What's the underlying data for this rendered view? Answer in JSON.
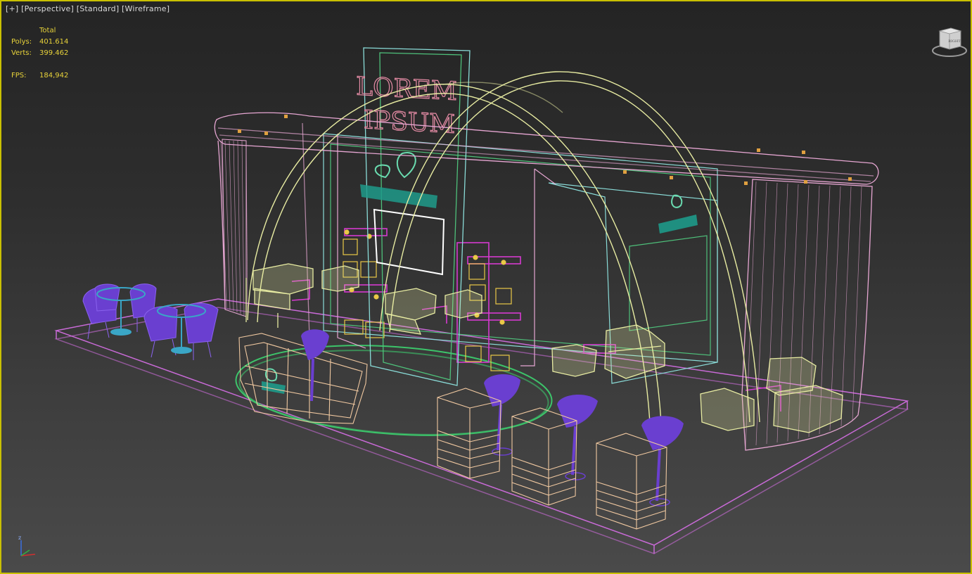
{
  "viewport": {
    "labels": [
      "[+]",
      "[Perspective]",
      "[Standard]",
      "[Wireframe]"
    ]
  },
  "stats": {
    "header": "Total",
    "polys_label": "Polys:",
    "polys_value": "401.614",
    "verts_label": "Verts:",
    "verts_value": "399.462",
    "fps_label": "FPS:",
    "fps_value": "184,942"
  },
  "scene": {
    "sign_line1": "LOREM",
    "sign_line2": "IPSUM"
  },
  "viewcube": {
    "face_label": "RIGHT"
  },
  "axis": {
    "z_label": "z"
  },
  "colors": {
    "viewport_border": "#c9c000",
    "stats_text": "#e8d33a",
    "curtain_pink": "#e6a6d2",
    "arch_yellow": "#e8eca2",
    "frame_cyan": "#8adcd8",
    "frame_green": "#4ec07a",
    "chair_purple": "#6a3fd0",
    "table_blue": "#3aa6c6",
    "counter_peach": "#f0c8a0",
    "magenta": "#d63ad0",
    "floor_violet": "#c86ad6",
    "logo_teal": "#1e9a8a"
  }
}
